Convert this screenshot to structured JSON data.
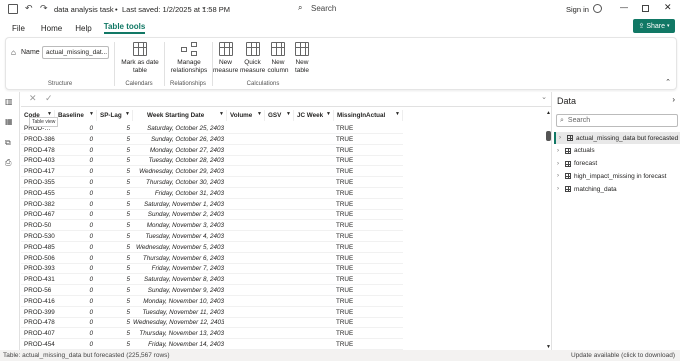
{
  "titlebar": {
    "title": "data analysis task",
    "saved": "Last saved: 1/2/2025 at 1:58 PM",
    "search_placeholder": "Search",
    "signin": "Sign in"
  },
  "menu": {
    "file": "File",
    "home": "Home",
    "help": "Help",
    "table_tools": "Table tools"
  },
  "share": {
    "label": "Share"
  },
  "ribbon": {
    "name_label": "Name",
    "name_value": "actual_missing_dat...",
    "structure": "Structure",
    "mark_as_date": "Mark as date table",
    "calendars": "Calendars",
    "manage_rel": "Manage relationships",
    "relationships": "Relationships",
    "new_measure": "New measure",
    "quick_measure": "Quick measure",
    "new_column": "New column",
    "new_table": "New table",
    "calculations": "Calculations"
  },
  "grid": {
    "tooltip": "Table view",
    "columns": [
      "Code",
      "Baseline",
      "SP-Lag",
      "Week Starting Date",
      "Volume",
      "GSV",
      "JC Week",
      "MissingInActual"
    ],
    "rows": [
      [
        "PROD-…",
        "0",
        "5",
        "Saturday, October 25, 2403",
        "TRUE"
      ],
      [
        "PROD-386",
        "0",
        "5",
        "Sunday, October 26, 2403",
        "TRUE"
      ],
      [
        "PROD-478",
        "0",
        "5",
        "Monday, October 27, 2403",
        "TRUE"
      ],
      [
        "PROD-403",
        "0",
        "5",
        "Tuesday, October 28, 2403",
        "TRUE"
      ],
      [
        "PROD-417",
        "0",
        "5",
        "Wednesday, October 29, 2403",
        "TRUE"
      ],
      [
        "PROD-355",
        "0",
        "5",
        "Thursday, October 30, 2403",
        "TRUE"
      ],
      [
        "PROD-455",
        "0",
        "5",
        "Friday, October 31, 2403",
        "TRUE"
      ],
      [
        "PROD-382",
        "0",
        "5",
        "Saturday, November 1, 2403",
        "TRUE"
      ],
      [
        "PROD-467",
        "0",
        "5",
        "Sunday, November 2, 2403",
        "TRUE"
      ],
      [
        "PROD-50",
        "0",
        "5",
        "Monday, November 3, 2403",
        "TRUE"
      ],
      [
        "PROD-530",
        "0",
        "5",
        "Tuesday, November 4, 2403",
        "TRUE"
      ],
      [
        "PROD-485",
        "0",
        "5",
        "Wednesday, November 5, 2403",
        "TRUE"
      ],
      [
        "PROD-506",
        "0",
        "5",
        "Thursday, November 6, 2403",
        "TRUE"
      ],
      [
        "PROD-393",
        "0",
        "5",
        "Friday, November 7, 2403",
        "TRUE"
      ],
      [
        "PROD-431",
        "0",
        "5",
        "Saturday, November 8, 2403",
        "TRUE"
      ],
      [
        "PROD-56",
        "0",
        "5",
        "Sunday, November 9, 2403",
        "TRUE"
      ],
      [
        "PROD-416",
        "0",
        "5",
        "Monday, November 10, 2403",
        "TRUE"
      ],
      [
        "PROD-399",
        "0",
        "5",
        "Tuesday, November 11, 2403",
        "TRUE"
      ],
      [
        "PROD-478",
        "0",
        "5",
        "Wednesday, November 12, 2403",
        "TRUE"
      ],
      [
        "PROD-407",
        "0",
        "5",
        "Thursday, November 13, 2403",
        "TRUE"
      ],
      [
        "PROD-454",
        "0",
        "5",
        "Friday, November 14, 2403",
        "TRUE"
      ]
    ]
  },
  "datapane": {
    "title": "Data",
    "search_placeholder": "Search",
    "tables": [
      "actual_missing_data but forecasted",
      "actuals",
      "forecast",
      "high_impact_missing in forecast",
      "matching_data"
    ]
  },
  "status": {
    "left": "Table: actual_missing_data but forecasted (225,567 rows)",
    "right": "Update available (click to download)"
  },
  "colors": {
    "accent": "#117865"
  }
}
